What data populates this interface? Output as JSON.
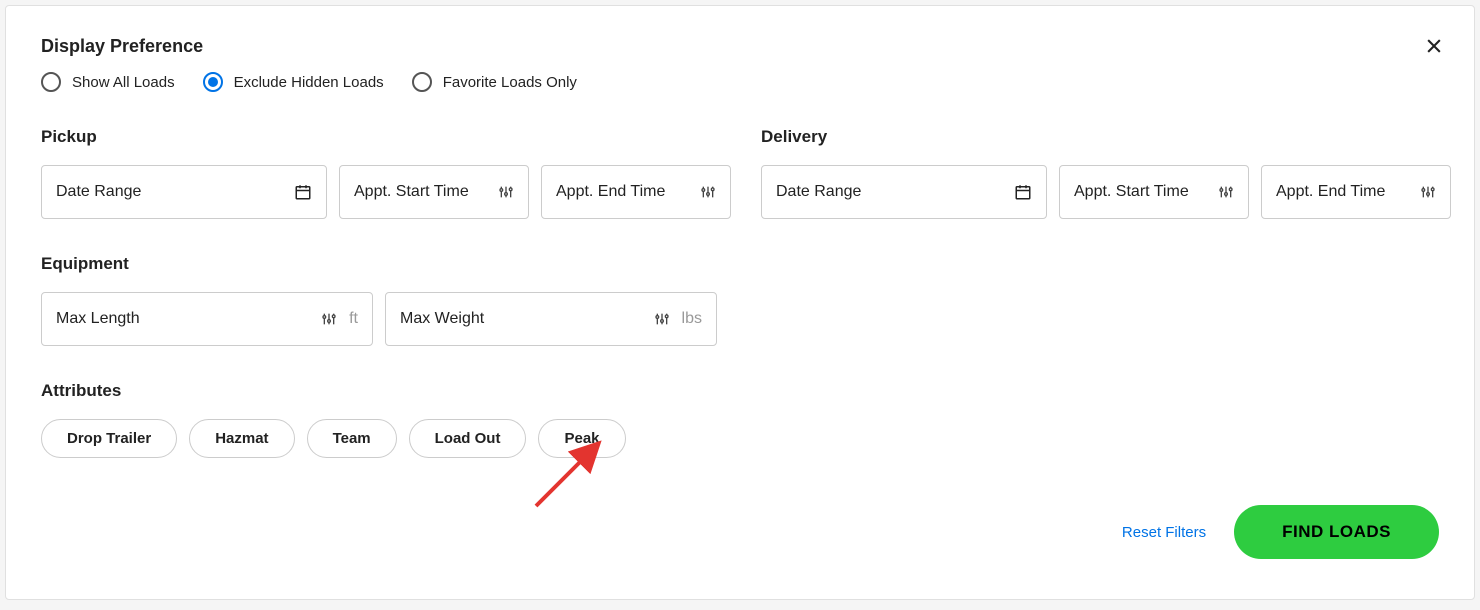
{
  "displayPreference": {
    "title": "Display Preference",
    "options": {
      "showAll": "Show All Loads",
      "excludeHidden": "Exclude Hidden Loads",
      "favoritesOnly": "Favorite Loads Only"
    },
    "selected": "excludeHidden"
  },
  "pickup": {
    "title": "Pickup",
    "dateRange": "Date Range",
    "apptStart": "Appt. Start Time",
    "apptEnd": "Appt. End Time"
  },
  "delivery": {
    "title": "Delivery",
    "dateRange": "Date Range",
    "apptStart": "Appt. Start Time",
    "apptEnd": "Appt. End Time"
  },
  "equipment": {
    "title": "Equipment",
    "maxLength": "Max Length",
    "maxLengthUnit": "ft",
    "maxWeight": "Max Weight",
    "maxWeightUnit": "lbs"
  },
  "attributes": {
    "title": "Attributes",
    "items": [
      "Drop Trailer",
      "Hazmat",
      "Team",
      "Load Out",
      "Peak"
    ]
  },
  "actions": {
    "reset": "Reset Filters",
    "find": "FIND LOADS"
  },
  "colors": {
    "accent": "#0073e6",
    "primaryButton": "#2ecc40"
  }
}
